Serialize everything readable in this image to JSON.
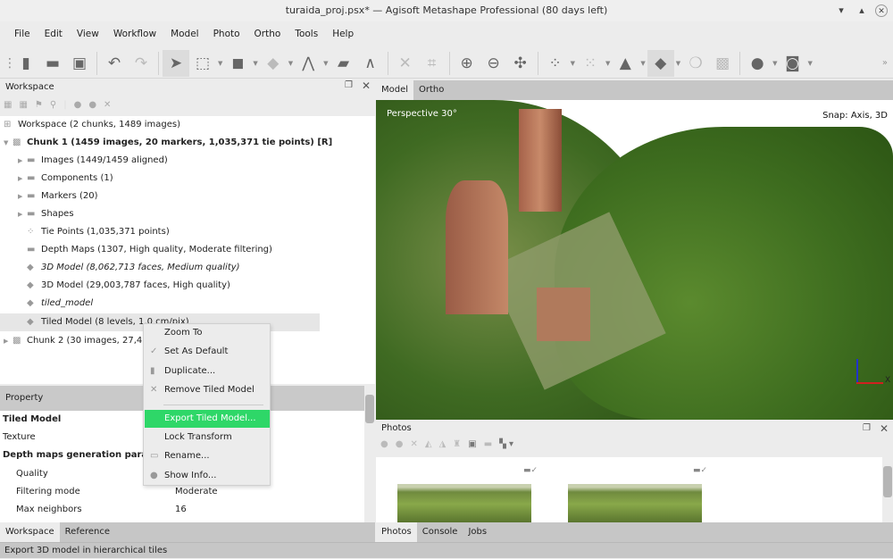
{
  "window": {
    "title": "turaida_proj.psx* — Agisoft Metashape Professional (80 days left)"
  },
  "menu": [
    "File",
    "Edit",
    "View",
    "Workflow",
    "Model",
    "Photo",
    "Ortho",
    "Tools",
    "Help"
  ],
  "workspace": {
    "title": "Workspace",
    "tree": [
      {
        "label": "Workspace (2 chunks, 1489 images)",
        "icon": "workspace-icon"
      },
      {
        "label": "Chunk 1 (1459 images, 20 markers, 1,035,371 tie points) [R]",
        "icon": "chunk-icon"
      },
      {
        "label": "Images (1449/1459 aligned)",
        "icon": "folder-icon"
      },
      {
        "label": "Components (1)",
        "icon": "folder-icon"
      },
      {
        "label": "Markers (20)",
        "icon": "folder-icon"
      },
      {
        "label": "Shapes",
        "icon": "folder-icon"
      },
      {
        "label": "Tie Points (1,035,371 points)",
        "icon": "points-icon"
      },
      {
        "label": "Depth Maps (1307, High quality, Moderate filtering)",
        "icon": "depth-maps-icon"
      },
      {
        "label": "3D Model (8,062,713 faces, Medium quality)",
        "icon": "model-icon"
      },
      {
        "label": "3D Model (29,003,787 faces, High quality)",
        "icon": "model-icon"
      },
      {
        "label": "tiled_model",
        "icon": "model-icon"
      },
      {
        "label": "Tiled Model (8 levels, 1.0 cm/pix)",
        "icon": "model-icon"
      },
      {
        "label": "Chunk 2 (30 images, 27,42",
        "icon": "chunk-icon"
      }
    ]
  },
  "property": {
    "header": "Property",
    "rows": [
      {
        "name": "Tiled Model",
        "value": "",
        "bold": true
      },
      {
        "name": "Texture",
        "value": ""
      },
      {
        "name": "Depth maps generation param",
        "value": "",
        "bold": true
      },
      {
        "name": "Quality",
        "value": ""
      },
      {
        "name": "Filtering mode",
        "value": "Moderate"
      },
      {
        "name": "Max neighbors",
        "value": "16"
      }
    ]
  },
  "left_tabs": [
    "Workspace",
    "Reference"
  ],
  "context_menu": [
    "Zoom To",
    "Set As Default",
    "Duplicate...",
    "Remove Tiled Model",
    "Export Tiled Model...",
    "Lock Transform",
    "Rename...",
    "Show Info..."
  ],
  "view": {
    "tabs": [
      "Model",
      "Ortho"
    ],
    "projection": "Perspective 30°",
    "snap": "Snap: Axis, 3D",
    "axis_label": "X"
  },
  "photos": {
    "title": "Photos"
  },
  "right_tabs": [
    "Photos",
    "Console",
    "Jobs"
  ],
  "status": "Export 3D model in hierarchical tiles",
  "colors": {
    "highlight": "#2ed768",
    "panel": "#ececec",
    "tabbar": "#c6c6c6"
  }
}
